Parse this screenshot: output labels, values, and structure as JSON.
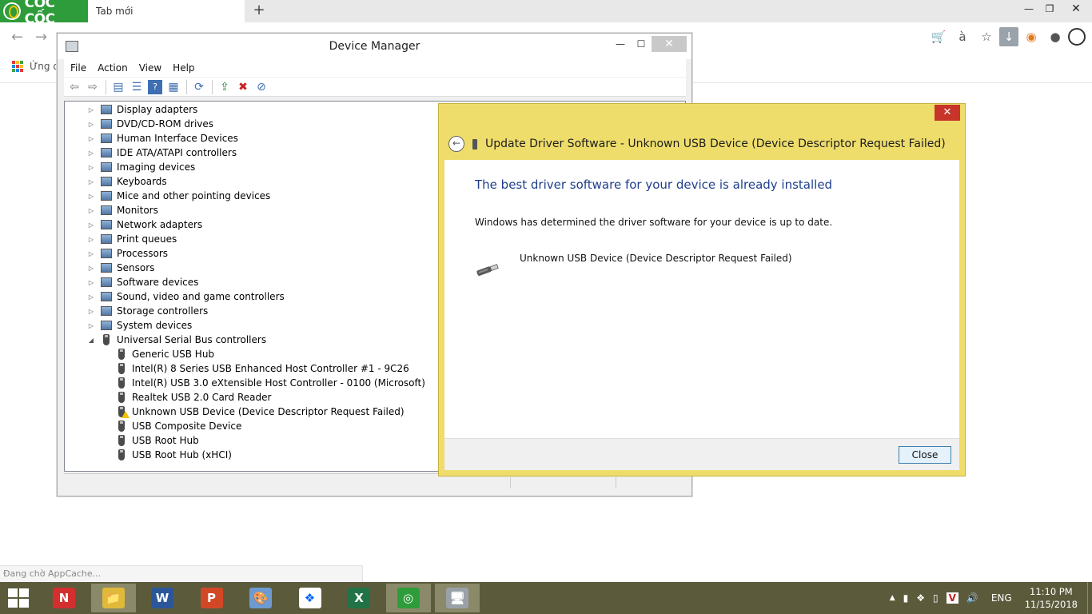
{
  "browser": {
    "brand": "CỐC CỐC",
    "tab_title": "Tab mới",
    "new_tab": "+",
    "bookmark_label": "Ứng d",
    "status_text": "Đang chờ AppCache...",
    "window_controls": {
      "minimize": "—",
      "maximize": "❐",
      "close": "✕"
    },
    "nav": {
      "back": "←",
      "forward": "→"
    },
    "toolbar_icons": {
      "cart": "🛒",
      "translate": "à",
      "star": "☆",
      "download": "↓",
      "extension": "◉",
      "account": "●"
    }
  },
  "device_manager": {
    "title": "Device Manager",
    "menu": [
      "File",
      "Action",
      "View",
      "Help"
    ],
    "window_controls": {
      "minimize": "—",
      "maximize": "☐",
      "close": "✕"
    },
    "toolbar_icons": {
      "back": "⇦",
      "forward": "⇨",
      "properties": "▤",
      "list": "☰",
      "help": "?",
      "view": "▦",
      "scan": "⟳",
      "update": "⇪",
      "uninstall": "✖",
      "disable": "⊘"
    },
    "tree": [
      {
        "label": "Display adapters",
        "expander": "▷",
        "icon": "monitor-icon"
      },
      {
        "label": "DVD/CD-ROM drives",
        "expander": "▷",
        "icon": "disc-drive-icon"
      },
      {
        "label": "Human Interface Devices",
        "expander": "▷",
        "icon": "hid-icon"
      },
      {
        "label": "IDE ATA/ATAPI controllers",
        "expander": "▷",
        "icon": "ide-controller-icon"
      },
      {
        "label": "Imaging devices",
        "expander": "▷",
        "icon": "camera-icon"
      },
      {
        "label": "Keyboards",
        "expander": "▷",
        "icon": "keyboard-icon"
      },
      {
        "label": "Mice and other pointing devices",
        "expander": "▷",
        "icon": "mouse-icon"
      },
      {
        "label": "Monitors",
        "expander": "▷",
        "icon": "monitor-icon"
      },
      {
        "label": "Network adapters",
        "expander": "▷",
        "icon": "network-icon"
      },
      {
        "label": "Print queues",
        "expander": "▷",
        "icon": "printer-icon"
      },
      {
        "label": "Processors",
        "expander": "▷",
        "icon": "cpu-icon"
      },
      {
        "label": "Sensors",
        "expander": "▷",
        "icon": "sensor-icon"
      },
      {
        "label": "Software devices",
        "expander": "▷",
        "icon": "software-device-icon"
      },
      {
        "label": "Sound, video and game controllers",
        "expander": "▷",
        "icon": "speaker-icon"
      },
      {
        "label": "Storage controllers",
        "expander": "▷",
        "icon": "storage-icon"
      },
      {
        "label": "System devices",
        "expander": "▷",
        "icon": "computer-icon"
      },
      {
        "label": "Universal Serial Bus controllers",
        "expander": "◢",
        "icon": "usb-icon"
      }
    ],
    "usb_children": [
      {
        "label": "Generic USB Hub",
        "warning": false
      },
      {
        "label": "Intel(R) 8 Series USB Enhanced Host Controller #1 - 9C26",
        "warning": false
      },
      {
        "label": "Intel(R) USB 3.0 eXtensible Host Controller - 0100 (Microsoft)",
        "warning": false
      },
      {
        "label": "Realtek USB 2.0 Card Reader",
        "warning": false
      },
      {
        "label": "Unknown USB Device (Device Descriptor Request Failed)",
        "warning": true
      },
      {
        "label": "USB Composite Device",
        "warning": false
      },
      {
        "label": "USB Root Hub",
        "warning": false
      },
      {
        "label": "USB Root Hub (xHCI)",
        "warning": false
      }
    ]
  },
  "update_dialog": {
    "title": "Update Driver Software - Unknown USB Device (Device Descriptor Request Failed)",
    "close_x": "✕",
    "back": "←",
    "heading": "The best driver software for your device is already installed",
    "description": "Windows has determined the driver software for your device is up to date.",
    "device_name": "Unknown USB Device (Device Descriptor Request Failed)",
    "close_button": "Close",
    "colors": {
      "frame": "#eedd6b",
      "heading": "#1e3e8c",
      "close_x_bg": "#c7342a"
    }
  },
  "taskbar": {
    "apps": [
      {
        "name": "unikey",
        "glyph": "N"
      },
      {
        "name": "file-explorer",
        "glyph": "📁"
      },
      {
        "name": "word",
        "glyph": "W"
      },
      {
        "name": "powerpoint",
        "glyph": "P"
      },
      {
        "name": "paint",
        "glyph": "🎨"
      },
      {
        "name": "dropbox",
        "glyph": "❖"
      },
      {
        "name": "excel",
        "glyph": "X"
      },
      {
        "name": "coccoc",
        "glyph": "◎"
      },
      {
        "name": "device-manager",
        "glyph": "🖥"
      }
    ],
    "tray": {
      "overflow": "▲",
      "signal": "▮",
      "dropbox": "❖",
      "battery": "▯",
      "vietkey": "V",
      "volume": "🔊"
    },
    "language": "ENG",
    "time": "11:10 PM",
    "date": "11/15/2018"
  }
}
